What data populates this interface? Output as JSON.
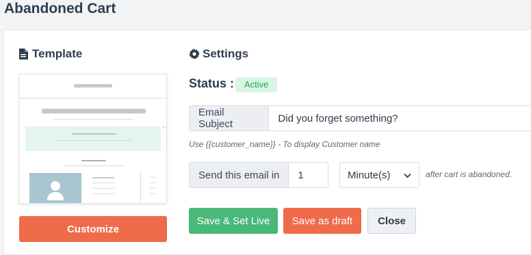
{
  "page": {
    "title": "Abandoned Cart"
  },
  "template": {
    "heading": "Template",
    "heading_icon": "file-text-icon",
    "customize_label": "Customize"
  },
  "settings": {
    "heading": "Settings",
    "heading_icon": "gear-icon",
    "status_label": "Status :",
    "status_value": "Active",
    "email_subject_label": "Email Subject",
    "email_subject_value": "Did you forget something?",
    "subject_hint": "Use {{customer_name}} - To display Customer name",
    "send_label": "Send this email in",
    "send_value": "1",
    "unit_selected": "Minute(s)",
    "after_text": "after cart is abandoned."
  },
  "actions": {
    "save_live": "Save & Set Live",
    "save_draft": "Save as draft",
    "close": "Close"
  },
  "colors": {
    "accent_orange": "#ef6b4a",
    "accent_green": "#49b878",
    "status_bg": "#d8f6e3",
    "status_text": "#22a55a"
  }
}
